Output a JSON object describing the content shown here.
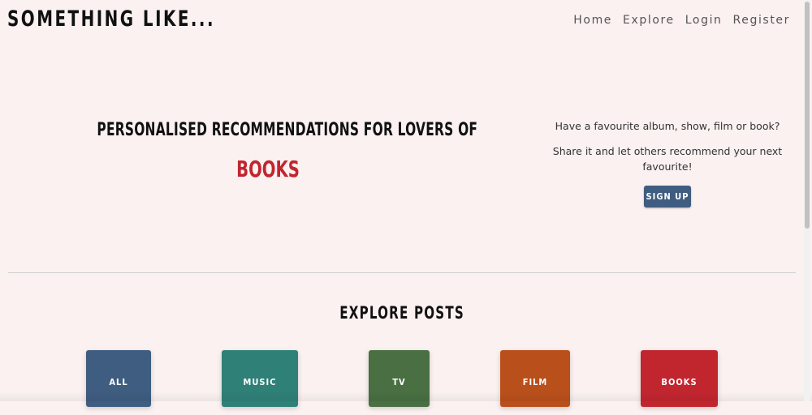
{
  "header": {
    "logo": "SOMETHING LIKE...",
    "nav": [
      "Home",
      "Explore",
      "Login",
      "Register"
    ]
  },
  "hero": {
    "title": "PERSONALISED RECOMMENDATIONS FOR LOVERS OF",
    "highlight_word": "BOOKS",
    "highlight_color": "#c1262f",
    "question": "Have a favourite album, show, film or book?",
    "subtext": "Share it and let others recommend your next favourite!",
    "signup_label": "SIGN UP"
  },
  "explore": {
    "title": "EXPLORE POSTS",
    "categories": [
      {
        "label": "ALL",
        "color": "#3f5d80"
      },
      {
        "label": "MUSIC",
        "color": "#2f8077"
      },
      {
        "label": "TV",
        "color": "#496f42"
      },
      {
        "label": "FILM",
        "color": "#b9501c"
      },
      {
        "label": "BOOKS",
        "color": "#c1262f"
      }
    ]
  },
  "colors": {
    "background": "#fbf1f1",
    "accent": "#3f5d80"
  }
}
